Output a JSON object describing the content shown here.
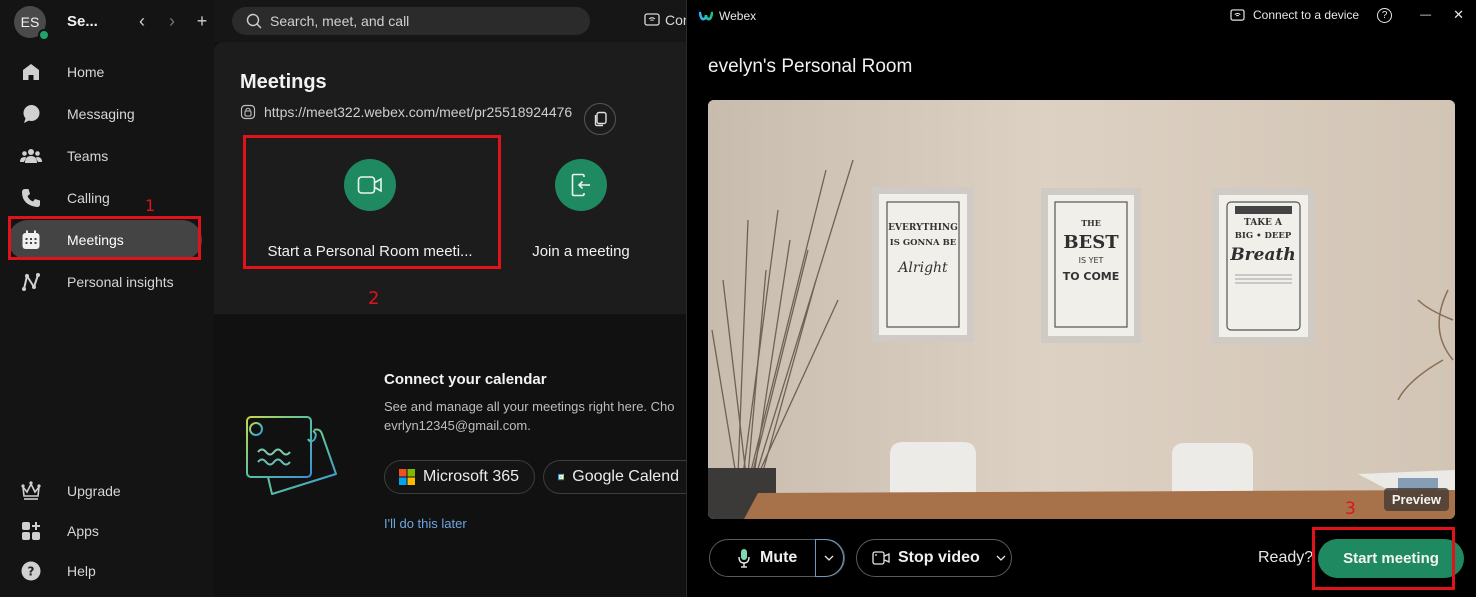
{
  "sidebar": {
    "avatar_initials": "ES",
    "user_name": "Se...",
    "nav_back": "‹",
    "nav_forward": "›",
    "nav_add": "+",
    "items": [
      {
        "label": "Home",
        "icon": "home-icon"
      },
      {
        "label": "Messaging",
        "icon": "chat-bubble-icon"
      },
      {
        "label": "Teams",
        "icon": "people-group-icon"
      },
      {
        "label": "Calling",
        "icon": "phone-icon"
      },
      {
        "label": "Meetings",
        "icon": "calendar-icon",
        "active": true
      },
      {
        "label": "Personal insights",
        "icon": "insights-icon"
      }
    ],
    "bottom_items": [
      {
        "label": "Upgrade",
        "icon": "crown-icon"
      },
      {
        "label": "Apps",
        "icon": "apps-grid-icon"
      },
      {
        "label": "Help",
        "icon": "help-icon"
      }
    ]
  },
  "topbar": {
    "search_placeholder": "Search, meet, and call",
    "connect_label": "Con"
  },
  "meetings": {
    "title": "Meetings",
    "url": "https://meet322.webex.com/meet/pr25518924476",
    "tiles": [
      {
        "label": "Start a Personal Room meeti...",
        "icon": "video-camera-icon"
      },
      {
        "label": "Join a meeting",
        "icon": "join-door-icon"
      }
    ],
    "calendar": {
      "title": "Connect your calendar",
      "description_line1": "See and manage all your meetings right here. Cho",
      "description_line2": "evrlyn12345@gmail.com.",
      "buttons": [
        {
          "label": "Microsoft 365",
          "icon": "microsoft-logo-icon"
        },
        {
          "label": "Google Calend",
          "icon": "google-calendar-icon"
        }
      ],
      "later_link": "I'll do this later"
    }
  },
  "annotations": [
    "1",
    "2",
    "3"
  ],
  "preview_window": {
    "app_name": "Webex",
    "connect_device": "Connect to a device",
    "help_icon": "?",
    "minimize_icon": "—",
    "close_icon": "✕",
    "room_title": "evelyn's Personal Room",
    "preview_badge": "Preview",
    "controls": {
      "mute_label": "Mute",
      "stop_video_label": "Stop video",
      "ready_label": "Ready?",
      "start_label": "Start meeting"
    },
    "posters": [
      [
        "EVERYTHING",
        "IS GONNA BE",
        "Alright"
      ],
      [
        "THE",
        "BEST",
        "IS YET",
        "TO COME"
      ],
      [
        "TAKE A",
        "BIG • DEEP",
        "Breath"
      ]
    ]
  },
  "colors": {
    "accent_green": "#1f8a62",
    "annotation_red": "#e0131b",
    "link_blue": "#6ea6e0"
  }
}
